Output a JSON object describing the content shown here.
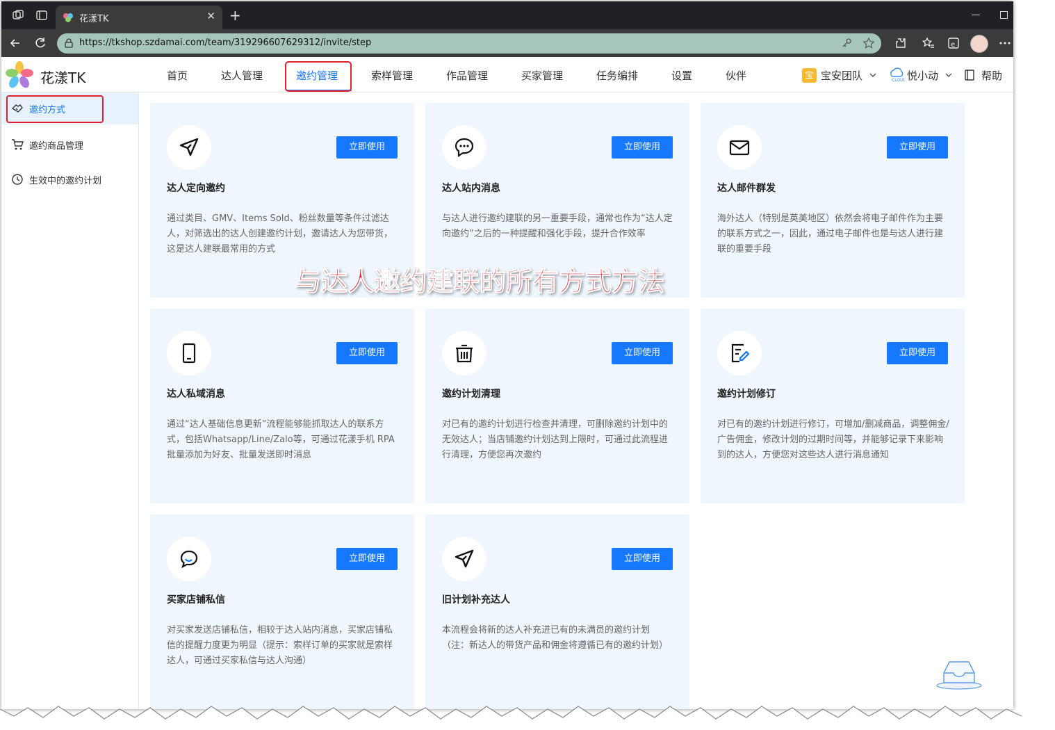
{
  "browser": {
    "tab_title": "花漾TK",
    "tab_close": "✕",
    "new_tab": "+",
    "url": "https://tkshop.szdamai.com/team/319296607629312/invite/step"
  },
  "header": {
    "app_name": "花漾TK",
    "nav": [
      "首页",
      "达人管理",
      "邀约管理",
      "索样管理",
      "作品管理",
      "买家管理",
      "任务编排",
      "设置",
      "伙伴"
    ],
    "active_nav": "邀约管理",
    "team_badge": "宝",
    "team": "宝安团队",
    "user": "悦小动",
    "help": "帮助"
  },
  "sidebar": {
    "items": [
      {
        "label": "邀约方式",
        "icon": "handshake-icon",
        "active": true
      },
      {
        "label": "邀约商品管理",
        "icon": "cart-icon",
        "active": false
      },
      {
        "label": "生效中的邀约计划",
        "icon": "clock-icon",
        "active": false
      }
    ]
  },
  "cards": [
    {
      "title": "达人定向邀约",
      "icon": "send-icon",
      "button": "立即使用",
      "desc": "通过类目、GMV、Items Sold、粉丝数量等条件过滤达人，对筛选出的达人创建邀约计划，邀请达人为您带货，这是达人建联最常用的方式"
    },
    {
      "title": "达人站内消息",
      "icon": "chat-bubble-icon",
      "button": "立即使用",
      "desc": "与达人进行邀约建联的另一重要手段，通常也作为“达人定向邀约”之后的一种提醒和强化手段，提升合作效率"
    },
    {
      "title": "达人邮件群发",
      "icon": "mail-icon",
      "button": "立即使用",
      "desc": "海外达人（特别是英美地区）依然会将电子邮件作为主要的联系方式之一，因此，通过电子邮件也是与达人进行建联的重要手段"
    },
    {
      "title": "达人私域消息",
      "icon": "mobile-icon",
      "button": "立即使用",
      "desc": "通过“达人基础信息更新”流程能够能抓取达人的联系方式，包括Whatsapp/Line/Zalo等，可通过花漾手机 RPA 批量添加为好友、批量发送即时消息"
    },
    {
      "title": "邀约计划清理",
      "icon": "trash-icon",
      "button": "立即使用",
      "desc": "对已有的邀约计划进行检查并清理，可删除邀约计划中的无效达人；当店铺邀约计划达到上限时，可通过此流程进行清理，方便您再次邀约"
    },
    {
      "title": "邀约计划修订",
      "icon": "edit-doc-icon",
      "button": "立即使用",
      "desc": "对已有的邀约计划进行修订，可增加/删减商品，调整佣金/广告佣金，修改计划的过期时间等，并能够记录下来影响到的达人，方便您对这些达人进行消息通知"
    },
    {
      "title": "买家店铺私信",
      "icon": "message-icon",
      "button": "立即使用",
      "desc": "对买家发送店铺私信，相较于达人站内消息，买家店铺私信的提醒力度更为明显（提示：索样订单的买家就是索样达人，可通过买家私信与达人沟通）"
    },
    {
      "title": "旧计划补充达人",
      "icon": "send-icon",
      "button": "立即使用",
      "desc": "本流程会将新的达人补充进已有的未满员的邀约计划（注：新达人的带货产品和佣金将遵循已有的邀约计划）"
    }
  ],
  "overlay_text": "与达人邀约建联的所有方式方法",
  "colors": {
    "accent": "#1677ff",
    "highlight": "#e0222d",
    "card_bg": "#f0f6fe"
  }
}
